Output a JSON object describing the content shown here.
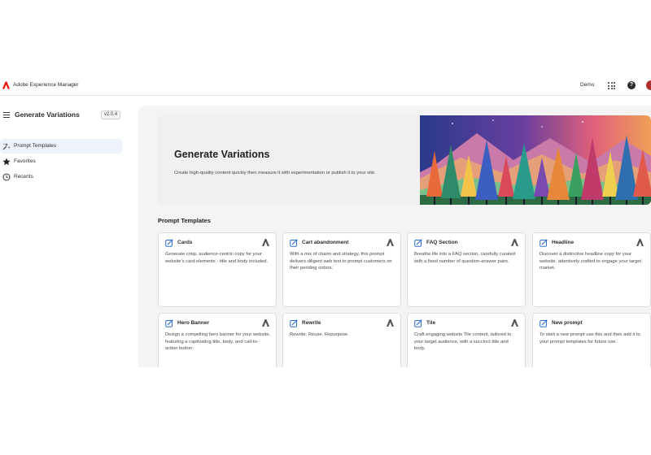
{
  "topbar": {
    "app_name": "Adobe Experience Manager",
    "user": "Demo",
    "help_glyph": "?"
  },
  "sidebar": {
    "title": "Generate Variations",
    "version": "v2.0.4",
    "items": [
      {
        "label": "Prompt Templates",
        "icon": "prompt-templates-icon",
        "active": true
      },
      {
        "label": "Favorites",
        "icon": "star-icon",
        "active": false
      },
      {
        "label": "Recents",
        "icon": "clock-icon",
        "active": false
      }
    ]
  },
  "hero": {
    "title": "Generate Variations",
    "subtitle": "Create high-quality content quickly then measure it with experimentation or publish it to your site."
  },
  "section_title": "Prompt Templates",
  "cards": [
    {
      "title": "Cards",
      "description": "Generate crisp, audience-centric copy for your website's card elements - title and body included."
    },
    {
      "title": "Cart abandonment",
      "description": "With a mix of charm and strategy, this prompt delivers diligent web text to prompt customers on their pending orders."
    },
    {
      "title": "FAQ Section",
      "description": "Breathe life into a FAQ section, carefully curated with a fixed number of question-answer pairs."
    },
    {
      "title": "Headline",
      "description": "Discover a distinctive headline copy for your website, attentively crafted to engage your target market."
    },
    {
      "title": "Hero Banner",
      "description": "Design a compelling hero banner for your website, featuring a captivating title, body, and call-to-action button."
    },
    {
      "title": "Rewrite",
      "description": "Rewrite. Reuse. Repurpose."
    },
    {
      "title": "Tile",
      "description": "Craft engaging website Tile content, tailored to your target audience, with a succinct title and body."
    },
    {
      "title": "New prompt",
      "description": "To start a new prompt use this and then add it to your prompt templates for future use."
    }
  ],
  "colors": {
    "accent": "#2d6fd1",
    "adobe_red": "#eb1000",
    "active_bg": "#eef3fb"
  }
}
